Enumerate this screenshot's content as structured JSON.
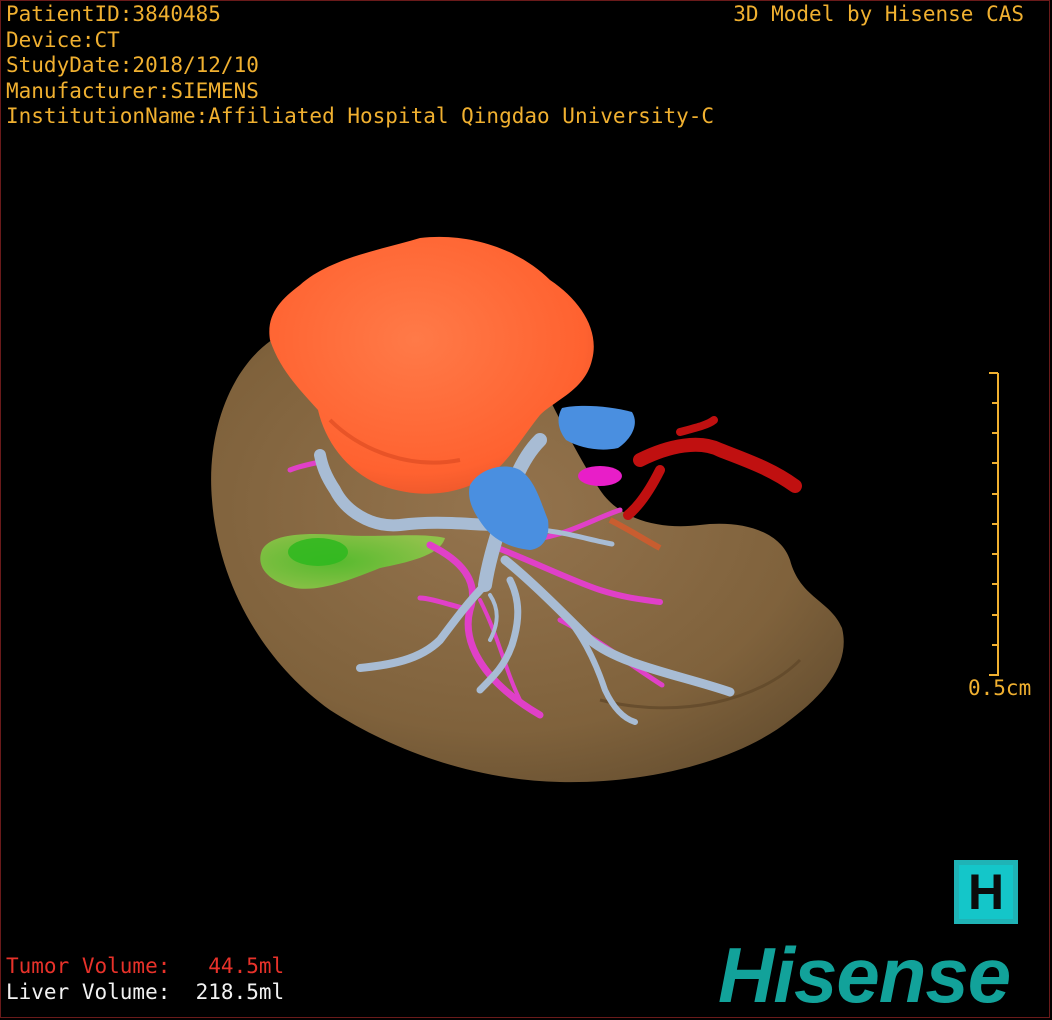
{
  "header": {
    "patient_id": "PatientID:3840485",
    "device": "Device:CT",
    "study_date": "StudyDate:2018/12/10",
    "manufacturer": "Manufacturer:SIEMENS",
    "institution": "InstitutionName:Affiliated Hospital Qingdao University-C",
    "credit": "3D Model by Hisense CAS"
  },
  "scale_bar": {
    "label": "0.5cm"
  },
  "volumes": {
    "tumor": "Tumor Volume:   44.5ml",
    "liver": "Liver Volume:  218.5ml"
  },
  "brand": {
    "mark": "H",
    "name": "Hisense"
  },
  "colors": {
    "overlay_text": "#f0b030",
    "tumor_text": "#e8322a",
    "liver_text": "#f2f2f2",
    "liver": "#8c6b45",
    "tumor": "#ff6a3a",
    "portal_vein": "#a8bcd4",
    "hepatic_artery": "#e040c8",
    "vena_cava": "#4a8fe0",
    "artery_red": "#c01010",
    "gallbladder": "#6fce2a",
    "brand": "#12a29a"
  }
}
